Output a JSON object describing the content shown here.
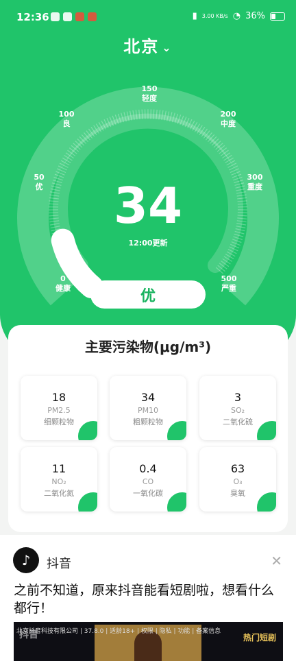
{
  "status_bar": {
    "time": "12:36",
    "network_speed": "3.00 KB/s",
    "battery": "36%"
  },
  "city": {
    "name": "北京",
    "chevron": "⌄"
  },
  "gauge": {
    "scale": [
      {
        "value": "0",
        "label": "健康"
      },
      {
        "value": "50",
        "label": "优"
      },
      {
        "value": "100",
        "label": "良"
      },
      {
        "value": "150",
        "label": "轻度"
      },
      {
        "value": "200",
        "label": "中度"
      },
      {
        "value": "300",
        "label": "重度"
      },
      {
        "value": "500",
        "label": "严重"
      }
    ],
    "aqi_value": "34",
    "aqi_fraction_of_scale": 0.068,
    "updated": "12:00更新",
    "level": "优",
    "colors": {
      "background": "#20c46a",
      "level_text": "#19b35f"
    }
  },
  "pollutants": {
    "title": "主要污染物(μg/m³)",
    "items": [
      {
        "value": "18",
        "code": "PM2.5",
        "name": "细颗粒物"
      },
      {
        "value": "34",
        "code": "PM10",
        "name": "粗颗粒物"
      },
      {
        "value": "3",
        "code": "SO₂",
        "name": "二氧化硫"
      },
      {
        "value": "11",
        "code": "NO₂",
        "name": "二氧化氮"
      },
      {
        "value": "0.4",
        "code": "CO",
        "name": "一氧化碳"
      },
      {
        "value": "63",
        "code": "O₃",
        "name": "臭氧"
      }
    ]
  },
  "ad": {
    "app_name": "抖音",
    "text": "之前不知道，原来抖音能看短剧啦，想看什么都行！",
    "license": "北京抖音科技有限公司 | 37.8.0 | 适龄18+ | 权限 | 隐私 | 功能 | 备案信息",
    "brand_watermark": "抖音",
    "media_tag": "热门短剧",
    "close_icon": "close-icon",
    "logo_icon": "tiktok-logo-icon"
  }
}
